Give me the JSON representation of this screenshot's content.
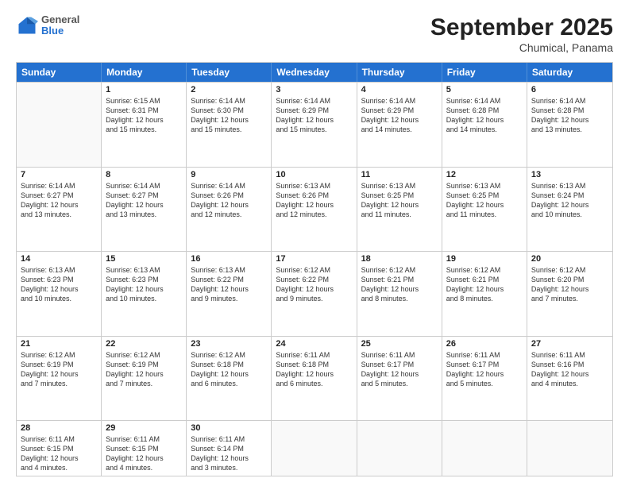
{
  "header": {
    "logo_general": "General",
    "logo_blue": "Blue",
    "month_year": "September 2025",
    "location": "Chumical, Panama"
  },
  "days_of_week": [
    "Sunday",
    "Monday",
    "Tuesday",
    "Wednesday",
    "Thursday",
    "Friday",
    "Saturday"
  ],
  "weeks": [
    [
      {
        "day": "",
        "empty": true
      },
      {
        "day": "1",
        "sunrise": "6:15 AM",
        "sunset": "6:31 PM",
        "daylight": "12 hours and 15 minutes."
      },
      {
        "day": "2",
        "sunrise": "6:14 AM",
        "sunset": "6:30 PM",
        "daylight": "12 hours and 15 minutes."
      },
      {
        "day": "3",
        "sunrise": "6:14 AM",
        "sunset": "6:29 PM",
        "daylight": "12 hours and 15 minutes."
      },
      {
        "day": "4",
        "sunrise": "6:14 AM",
        "sunset": "6:29 PM",
        "daylight": "12 hours and 14 minutes."
      },
      {
        "day": "5",
        "sunrise": "6:14 AM",
        "sunset": "6:28 PM",
        "daylight": "12 hours and 14 minutes."
      },
      {
        "day": "6",
        "sunrise": "6:14 AM",
        "sunset": "6:28 PM",
        "daylight": "12 hours and 13 minutes."
      }
    ],
    [
      {
        "day": "7",
        "sunrise": "6:14 AM",
        "sunset": "6:27 PM",
        "daylight": "12 hours and 13 minutes."
      },
      {
        "day": "8",
        "sunrise": "6:14 AM",
        "sunset": "6:27 PM",
        "daylight": "12 hours and 13 minutes."
      },
      {
        "day": "9",
        "sunrise": "6:14 AM",
        "sunset": "6:26 PM",
        "daylight": "12 hours and 12 minutes."
      },
      {
        "day": "10",
        "sunrise": "6:13 AM",
        "sunset": "6:26 PM",
        "daylight": "12 hours and 12 minutes."
      },
      {
        "day": "11",
        "sunrise": "6:13 AM",
        "sunset": "6:25 PM",
        "daylight": "12 hours and 11 minutes."
      },
      {
        "day": "12",
        "sunrise": "6:13 AM",
        "sunset": "6:25 PM",
        "daylight": "12 hours and 11 minutes."
      },
      {
        "day": "13",
        "sunrise": "6:13 AM",
        "sunset": "6:24 PM",
        "daylight": "12 hours and 10 minutes."
      }
    ],
    [
      {
        "day": "14",
        "sunrise": "6:13 AM",
        "sunset": "6:23 PM",
        "daylight": "12 hours and 10 minutes."
      },
      {
        "day": "15",
        "sunrise": "6:13 AM",
        "sunset": "6:23 PM",
        "daylight": "12 hours and 10 minutes."
      },
      {
        "day": "16",
        "sunrise": "6:13 AM",
        "sunset": "6:22 PM",
        "daylight": "12 hours and 9 minutes."
      },
      {
        "day": "17",
        "sunrise": "6:12 AM",
        "sunset": "6:22 PM",
        "daylight": "12 hours and 9 minutes."
      },
      {
        "day": "18",
        "sunrise": "6:12 AM",
        "sunset": "6:21 PM",
        "daylight": "12 hours and 8 minutes."
      },
      {
        "day": "19",
        "sunrise": "6:12 AM",
        "sunset": "6:21 PM",
        "daylight": "12 hours and 8 minutes."
      },
      {
        "day": "20",
        "sunrise": "6:12 AM",
        "sunset": "6:20 PM",
        "daylight": "12 hours and 7 minutes."
      }
    ],
    [
      {
        "day": "21",
        "sunrise": "6:12 AM",
        "sunset": "6:19 PM",
        "daylight": "12 hours and 7 minutes."
      },
      {
        "day": "22",
        "sunrise": "6:12 AM",
        "sunset": "6:19 PM",
        "daylight": "12 hours and 7 minutes."
      },
      {
        "day": "23",
        "sunrise": "6:12 AM",
        "sunset": "6:18 PM",
        "daylight": "12 hours and 6 minutes."
      },
      {
        "day": "24",
        "sunrise": "6:11 AM",
        "sunset": "6:18 PM",
        "daylight": "12 hours and 6 minutes."
      },
      {
        "day": "25",
        "sunrise": "6:11 AM",
        "sunset": "6:17 PM",
        "daylight": "12 hours and 5 minutes."
      },
      {
        "day": "26",
        "sunrise": "6:11 AM",
        "sunset": "6:17 PM",
        "daylight": "12 hours and 5 minutes."
      },
      {
        "day": "27",
        "sunrise": "6:11 AM",
        "sunset": "6:16 PM",
        "daylight": "12 hours and 4 minutes."
      }
    ],
    [
      {
        "day": "28",
        "sunrise": "6:11 AM",
        "sunset": "6:15 PM",
        "daylight": "12 hours and 4 minutes."
      },
      {
        "day": "29",
        "sunrise": "6:11 AM",
        "sunset": "6:15 PM",
        "daylight": "12 hours and 4 minutes."
      },
      {
        "day": "30",
        "sunrise": "6:11 AM",
        "sunset": "6:14 PM",
        "daylight": "12 hours and 3 minutes."
      },
      {
        "day": "",
        "empty": true
      },
      {
        "day": "",
        "empty": true
      },
      {
        "day": "",
        "empty": true
      },
      {
        "day": "",
        "empty": true
      }
    ]
  ]
}
